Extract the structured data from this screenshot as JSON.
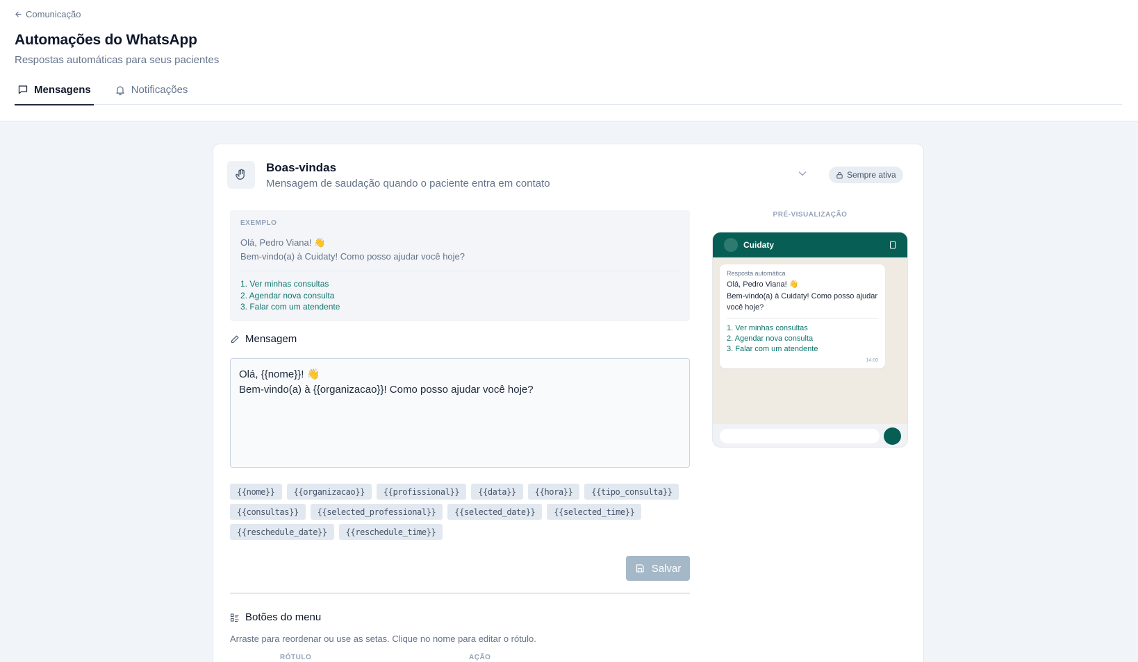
{
  "breadcrumb": {
    "back_label": "Comunicação"
  },
  "header": {
    "title": "Automações do WhatsApp",
    "subtitle": "Respostas automáticas para seus pacientes"
  },
  "tabs": [
    {
      "label": "Mensagens",
      "icon": "message-square-icon",
      "active": true
    },
    {
      "label": "Notificações",
      "icon": "bell-icon",
      "active": false
    }
  ],
  "automation": {
    "icon": "hand-icon",
    "title": "Boas-vindas",
    "description": "Mensagem de saudação quando o paciente entra em contato",
    "badge": "Sempre ativa",
    "example": {
      "label": "EXEMPLO",
      "text": "Olá, Pedro Viana! 👋\nBem-vindo(a) à Cuidaty! Como posso ajudar você hoje?",
      "options": [
        "1. Ver minhas consultas",
        "2. Agendar nova consulta",
        "3. Falar com um atendente"
      ]
    },
    "message": {
      "heading": "Mensagem",
      "value": "Olá, {{nome}}! 👋\nBem-vindo(a) à {{organizacao}}! Como posso ajudar você hoje?"
    },
    "variables": [
      "{{nome}}",
      "{{organizacao}}",
      "{{profissional}}",
      "{{data}}",
      "{{hora}}",
      "{{tipo_consulta}}",
      "{{consultas}}",
      "{{selected_professional}}",
      "{{selected_date}}",
      "{{selected_time}}",
      "{{reschedule_date}}",
      "{{reschedule_time}}"
    ],
    "save_label": "Salvar",
    "menu": {
      "heading": "Botões do menu",
      "description": "Arraste para reordenar ou use as setas. Clique no nome para editar o rótulo.",
      "columns": [
        "RÓTULO",
        "AÇÃO"
      ]
    }
  },
  "preview": {
    "label": "PRÉ-VISUALIZAÇÃO",
    "contact_name": "Cuidaty",
    "auto_label": "Resposta automática",
    "text": "Olá, Pedro Viana! 👋\nBem-vindo(a) à Cuidaty! Como posso ajudar você hoje?",
    "options": [
      "1. Ver minhas consultas",
      "2. Agendar nova consulta",
      "3. Falar com um atendente"
    ],
    "time": "14:00"
  },
  "colors": {
    "whatsapp_header": "#075e54",
    "option_text": "#0f766e",
    "save_disabled": "#a5b8c8"
  }
}
